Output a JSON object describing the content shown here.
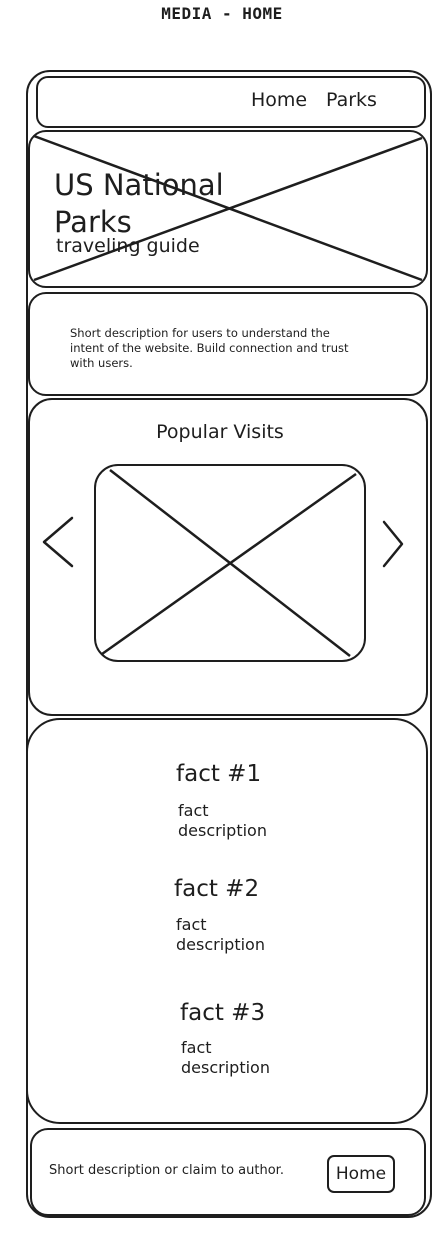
{
  "page_title": "MEDIA - HOME",
  "nav": {
    "home_label": "Home",
    "parks_label": "Parks"
  },
  "hero": {
    "title_line1": "US National",
    "title_line2": "Parks",
    "subtitle": "traveling guide",
    "image_placeholder": "image-placeholder-icon"
  },
  "intro": {
    "lines": [
      "Short description for users to understand the",
      "intent of the website. Build connection and trust",
      "with users."
    ]
  },
  "carousel": {
    "title": "Popular Visits",
    "prev_icon": "chevron-left-icon",
    "next_icon": "chevron-right-icon",
    "image_placeholder": "image-placeholder-icon"
  },
  "facts": [
    {
      "title": "fact #1",
      "desc_line1": "fact",
      "desc_line2": "description"
    },
    {
      "title": "fact #2",
      "desc_line1": "fact",
      "desc_line2": "description"
    },
    {
      "title": "fact #3",
      "desc_line1": "fact",
      "desc_line2": "description"
    }
  ],
  "footer": {
    "text": "Short description or claim to author.",
    "home_button": "Home"
  }
}
